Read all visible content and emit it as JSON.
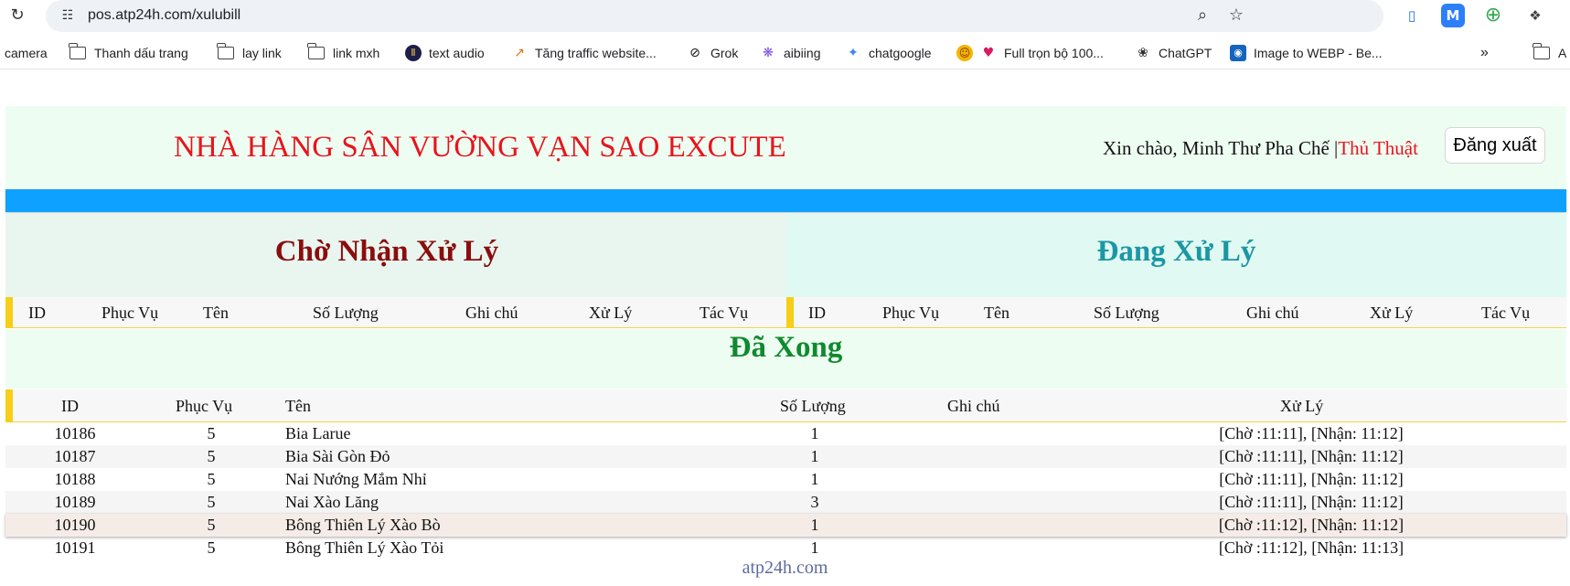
{
  "browser": {
    "url": "pos.atp24h.com/xulubill",
    "bookmarks": [
      {
        "label": "camera",
        "icon": "none"
      },
      {
        "label": "Thanh dấu trang",
        "icon": "folder-icon"
      },
      {
        "label": "lay link",
        "icon": "folder-icon"
      },
      {
        "label": "link mxh",
        "icon": "folder-icon"
      },
      {
        "label": "text audio",
        "icon": "audio-icon"
      },
      {
        "label": "Tăng traffic website...",
        "icon": "chart-icon"
      },
      {
        "label": "Grok",
        "icon": "grok-icon"
      },
      {
        "label": "aibiing",
        "icon": "copilot-icon"
      },
      {
        "label": "chatgoogle",
        "icon": "gemini-icon"
      },
      {
        "label": "Full trọn bộ 100...",
        "icon": "emoji-icon"
      },
      {
        "label": "ChatGPT",
        "icon": "openai-icon"
      },
      {
        "label": "Image to WEBP - Be...",
        "icon": "webp-icon"
      }
    ],
    "more_label": "»",
    "last_bookmark_label": "A"
  },
  "header": {
    "title": "NHÀ HÀNG SÂN VƯỜNG VẠN SAO EXCUTE",
    "greeting": "Xin chào, Minh Thư Pha Chế |",
    "tips_link": "Thủ Thuật",
    "logout_label": "Đăng xuất"
  },
  "colors": {
    "accent_blue": "#0ea1ff",
    "title_red": "#e8141c",
    "pending_title": "#8b0d0d",
    "processing_title": "#1b97a4",
    "done_title": "#0f8a2e",
    "header_accent": "#f6cf16"
  },
  "pending": {
    "title": "Chờ Nhận Xử Lý",
    "columns": [
      "ID",
      "Phục Vụ",
      "Tên",
      "Số Lượng",
      "Ghi chú",
      "Xử Lý",
      "Tác Vụ"
    ]
  },
  "processing": {
    "title": "Đang Xử Lý",
    "columns": [
      "ID",
      "Phục Vụ",
      "Tên",
      "Số Lượng",
      "Ghi chú",
      "Xử Lý",
      "Tác Vụ"
    ]
  },
  "done": {
    "title": "Đã Xong",
    "columns": [
      "ID",
      "Phục Vụ",
      "Tên",
      "Số Lượng",
      "Ghi chú",
      "Xử Lý"
    ],
    "rows": [
      {
        "id": "10186",
        "server": "5",
        "name": "Bia Larue",
        "qty": "1",
        "note": "",
        "process": "[Chờ :11:11], [Nhận: 11:12]"
      },
      {
        "id": "10187",
        "server": "5",
        "name": "Bia Sài Gòn Đỏ",
        "qty": "1",
        "note": "",
        "process": "[Chờ :11:11], [Nhận: 11:12]"
      },
      {
        "id": "10188",
        "server": "5",
        "name": "Nai Nướng Mắm Nhỉ",
        "qty": "1",
        "note": "",
        "process": "[Chờ :11:11], [Nhận: 11:12]"
      },
      {
        "id": "10189",
        "server": "5",
        "name": "Nai Xào Lăng",
        "qty": "3",
        "note": "",
        "process": "[Chờ :11:11], [Nhận: 11:12]"
      },
      {
        "id": "10190",
        "server": "5",
        "name": "Bông Thiên Lý Xào Bò",
        "qty": "1",
        "note": "",
        "process": "[Chờ :11:12], [Nhận: 11:12]"
      },
      {
        "id": "10191",
        "server": "5",
        "name": "Bông Thiên Lý Xào Tỏi",
        "qty": "1",
        "note": "",
        "process": "[Chờ :11:12], [Nhận: 11:13]"
      }
    ]
  },
  "footer": {
    "link": "atp24h.com"
  }
}
